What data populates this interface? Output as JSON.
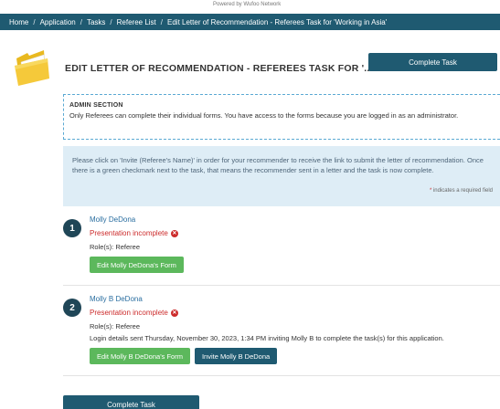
{
  "header": {
    "powered_by": "Powered by Wufoo Network"
  },
  "breadcrumb": {
    "items": [
      "Home",
      "Application",
      "Tasks",
      "Referee List",
      "Edit Letter of Recommendation - Referees Task for 'Working in Asia'"
    ],
    "separator": "/"
  },
  "page": {
    "icon": "folder-icon",
    "title": "EDIT LETTER OF RECOMMENDATION - REFEREES TASK FOR '...",
    "complete_task_label": "Complete Task"
  },
  "admin_section": {
    "title": "ADMIN SECTION",
    "text": "Only Referees can complete their individual forms. You have access to the forms because you are logged in as an administrator."
  },
  "info": {
    "text": "Please click on 'Invite (Referee's Name)' in order for your recommender to receive the link to submit the letter of recommendation. Once there is a green checkmark next to the task, that means the recommender sent in a letter and the task is now complete.",
    "required_star": "*",
    "required_note": "indicates a required field"
  },
  "referees": [
    {
      "number": "1",
      "name": "Molly DeDona",
      "status": "Presentation incomplete",
      "roles": "Role(s): Referee",
      "edit_label": "Edit Molly DeDona's Form"
    },
    {
      "number": "2",
      "name": "Molly B DeDona",
      "status": "Presentation incomplete",
      "roles": "Role(s): Referee",
      "login_details": "Login details sent Thursday, November 30, 2023, 1:34 PM inviting Molly B to complete the task(s) for this application.",
      "edit_label": "Edit Molly B DeDona's Form",
      "invite_label": "Invite Molly B DeDona"
    }
  ],
  "footer": {
    "complete_task_label": "Complete Task"
  },
  "colors": {
    "primary": "#1f5a71",
    "success": "#5cb85c",
    "danger": "#cc2b2b",
    "info_bg": "#deedf6",
    "link": "#2a6ea0"
  }
}
